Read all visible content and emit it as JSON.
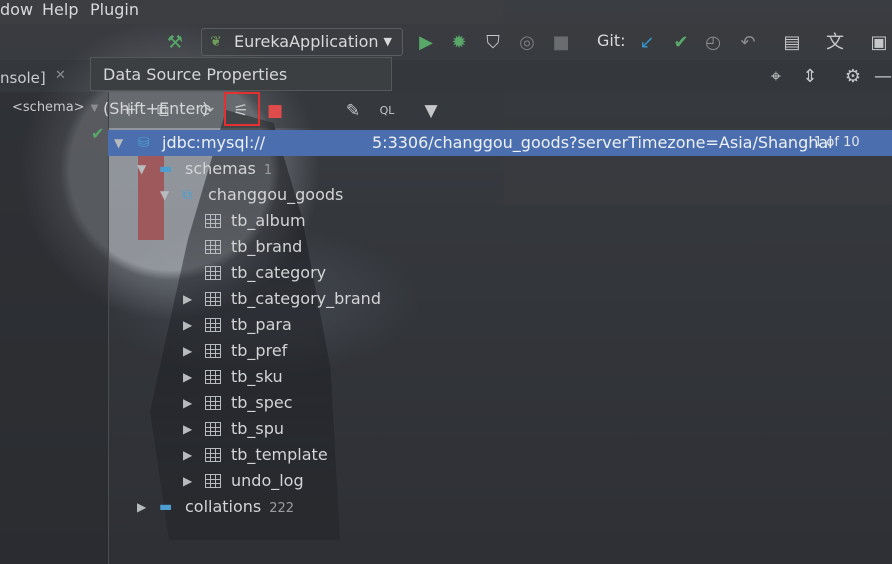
{
  "menu": {
    "items": [
      "dow",
      "Help",
      "Plugin"
    ]
  },
  "toolbar": {
    "run_config": "EurekaApplication",
    "git_label": "Git:"
  },
  "tooltip": "Data Source Properties (Shift+Enter)",
  "console_tab": "nsole]",
  "schema_selector": "<schema>",
  "tree": {
    "datasource": {
      "url_prefix": "jdbc:mysql://",
      "url_suffix": "5:3306/changgou_goods?serverTimezone=Asia/Shanghai",
      "count": "1 of 10"
    },
    "schemas": {
      "label": "schemas",
      "count": "1"
    },
    "database": "changgou_goods",
    "tables": [
      {
        "name": "tb_album",
        "expandable": false
      },
      {
        "name": "tb_brand",
        "expandable": false
      },
      {
        "name": "tb_category",
        "expandable": false
      },
      {
        "name": "tb_category_brand",
        "expandable": true
      },
      {
        "name": "tb_para",
        "expandable": true
      },
      {
        "name": "tb_pref",
        "expandable": true
      },
      {
        "name": "tb_sku",
        "expandable": true
      },
      {
        "name": "tb_spec",
        "expandable": true
      },
      {
        "name": "tb_spu",
        "expandable": true
      },
      {
        "name": "tb_template",
        "expandable": true
      },
      {
        "name": "undo_log",
        "expandable": true
      }
    ],
    "collations": {
      "label": "collations",
      "count": "222"
    }
  },
  "colors": {
    "selection": "#4b6eaf",
    "highlight_box": "#e53030",
    "run_green": "#59a869",
    "git_blue": "#3592c4"
  }
}
